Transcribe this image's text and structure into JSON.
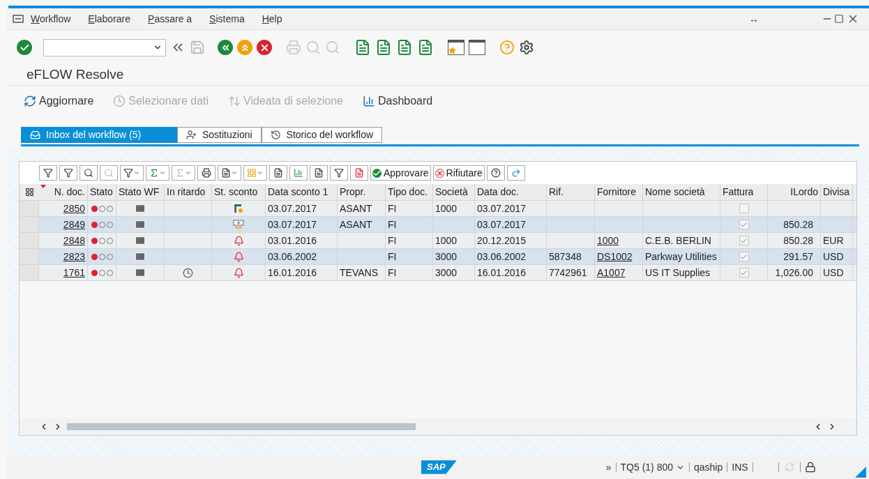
{
  "menu": [
    {
      "label": "Workflow"
    },
    {
      "label": "Elaborare"
    },
    {
      "label": "Passare a"
    },
    {
      "label": "Sistema"
    },
    {
      "label": "Help"
    }
  ],
  "window_controls": {
    "resize": "↔"
  },
  "title": "eFLOW Resolve",
  "app_toolbar": [
    {
      "label": "Aggiornare",
      "disabled": false,
      "kind": "refresh"
    },
    {
      "label": "Selezionare dati",
      "disabled": true,
      "kind": "select"
    },
    {
      "label": "Videata di selezione",
      "disabled": true,
      "kind": "screen"
    },
    {
      "label": "Dashboard",
      "disabled": false,
      "kind": "dashboard"
    }
  ],
  "tabs": [
    {
      "label": "Inbox del workflow (5)",
      "selected": true,
      "kind": "inbox"
    },
    {
      "label": "Sostituzioni",
      "selected": false,
      "kind": "subst"
    },
    {
      "label": "Storico del workflow",
      "selected": false,
      "kind": "history"
    }
  ],
  "grid": {
    "actions": [
      {
        "label": "Approvare",
        "kind": "approve"
      },
      {
        "label": "Rifiutare",
        "kind": "reject"
      }
    ],
    "columns": [
      {
        "label": "N. doc.",
        "sorted": true
      },
      {
        "label": "Stato",
        "sorted": false
      },
      {
        "label": "Stato WF",
        "sorted": false
      },
      {
        "label": "In ritardo",
        "sorted": false
      },
      {
        "label": "St. sconto",
        "sorted": false
      },
      {
        "label": "Data sconto 1",
        "sorted": false
      },
      {
        "label": "Propr.",
        "sorted": false
      },
      {
        "label": "Tipo doc.",
        "sorted": false
      },
      {
        "label": "Società",
        "sorted": false
      },
      {
        "label": "Data doc.",
        "sorted": false
      },
      {
        "label": "Rif.",
        "sorted": false
      },
      {
        "label": "Fornitore",
        "sorted": false
      },
      {
        "label": "Nome società",
        "sorted": false
      },
      {
        "label": "Fattura",
        "sorted": false
      },
      {
        "label": "ILordo",
        "sorted": false
      },
      {
        "label": "Divisa",
        "sorted": false
      }
    ],
    "rows": [
      {
        "doc": "2850",
        "status": {
          "color": "#e0202a"
        },
        "delayed": false,
        "discount": {
          "kind": "flag"
        },
        "discount_date": "03.07.2017",
        "owner": "ASANT",
        "doc_type": "FI",
        "company": "1000",
        "doc_date": "03.07.2017",
        "ref": "",
        "vendor": "",
        "vendor_name": "",
        "invoice": false,
        "gross": "",
        "currency": ""
      },
      {
        "doc": "2849",
        "status": {
          "color": "#e0202a"
        },
        "delayed": false,
        "discount": {
          "kind": "money"
        },
        "discount_date": "03.07.2017",
        "owner": "ASANT",
        "doc_type": "FI",
        "company": "",
        "doc_date": "03.07.2017",
        "ref": "",
        "vendor": "",
        "vendor_name": "",
        "invoice": true,
        "gross": "850.28",
        "currency": ""
      },
      {
        "doc": "2848",
        "status": {
          "color": "#e0202a"
        },
        "delayed": false,
        "discount": {
          "kind": "alarm"
        },
        "discount_date": "03.01.2016",
        "owner": "",
        "doc_type": "FI",
        "company": "1000",
        "doc_date": "20.12.2015",
        "ref": "",
        "vendor": "1000",
        "vendor_name": "C.E.B. BERLIN",
        "invoice": true,
        "gross": "850.28",
        "currency": "EUR"
      },
      {
        "doc": "2823",
        "status": {
          "color": "#e0202a"
        },
        "delayed": false,
        "discount": {
          "kind": "alarm"
        },
        "discount_date": "03.06.2002",
        "owner": "",
        "doc_type": "FI",
        "company": "3000",
        "doc_date": "03.06.2002",
        "ref": "587348",
        "vendor": "DS1002",
        "vendor_name": "Parkway Utilities",
        "invoice": true,
        "gross": "291.57",
        "currency": "USD"
      },
      {
        "doc": "1761",
        "status": {
          "color": "#e0202a"
        },
        "delayed": true,
        "discount": {
          "kind": "alarm"
        },
        "discount_date": "16.01.2016",
        "owner": "TEVANS",
        "doc_type": "FI",
        "company": "3000",
        "doc_date": "16.01.2016",
        "ref": "7742961",
        "vendor": "A1007",
        "vendor_name": "US IT Supplies",
        "invoice": true,
        "gross": "1,026.00",
        "currency": "USD"
      }
    ]
  },
  "status_bar": {
    "expand": "»",
    "system": "TQ5 (1) 800",
    "user": "qaship",
    "mode": "INS"
  },
  "logo": "SAP"
}
